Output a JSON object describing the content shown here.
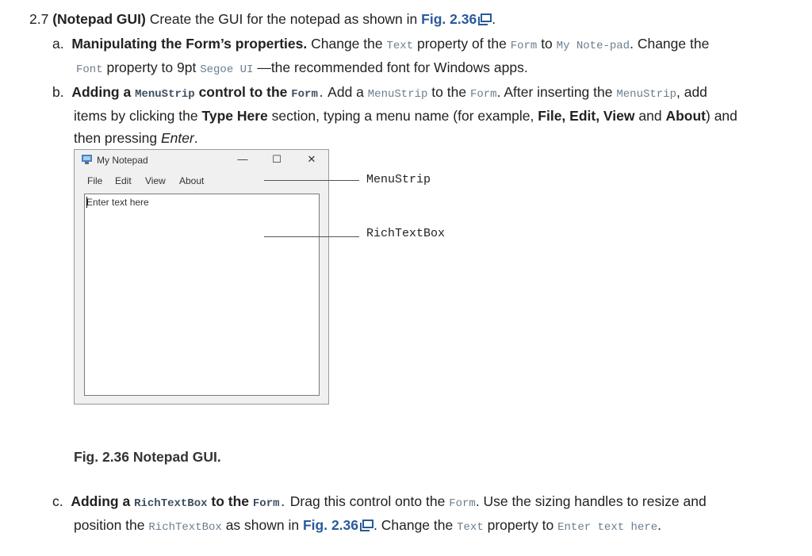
{
  "exercise": {
    "number": "2.7",
    "title": "(Notepad GUI)",
    "intro": "Create the GUI for the notepad as shown in",
    "fig_ref": "Fig. 2.36",
    "end": "."
  },
  "item_a": {
    "letter": "a.",
    "heading": "Manipulating the Form’s properties.",
    "t1": "Change the",
    "c1": "Text",
    "t2": "property of the",
    "c2": "Form",
    "t3": "to",
    "c3": "My Note-pad",
    "t4": ". Change the",
    "c4": "Font",
    "t5": "property to 9pt",
    "c5": "Segoe UI",
    "t6": "—the recommended font for Windows apps."
  },
  "item_b": {
    "letter": "b.",
    "h1": "Adding a",
    "hc1": "MenuStrip",
    "h2": "control to the",
    "hc2": "Form.",
    "t1": "Add a",
    "c1": "MenuStrip",
    "t2": "to the",
    "c2": "Form",
    "t3": ". After inserting the",
    "c3": "MenuStrip",
    "t4": ", add",
    "l2a": "items by clicking the",
    "l2b": "Type Here",
    "l2c": "section, typing a menu name (for example,",
    "l2d": "File, Edit, View",
    "l2e": "and",
    "l2f": "About",
    "l2g": ") and",
    "l3a": "then pressing",
    "l3b": "Enter",
    "l3c": "."
  },
  "window": {
    "title": "My Notepad",
    "minimize": "—",
    "maximize": "☐",
    "close": "✕",
    "menu": [
      "File",
      "Edit",
      "View",
      "About"
    ],
    "textbox_text": "Enter text here"
  },
  "callouts": {
    "menustrip": "MenuStrip",
    "richtextbox": "RichTextBox"
  },
  "figure_caption": "Fig. 2.36 Notepad GUI.",
  "item_c": {
    "letter": "c.",
    "h1": "Adding a",
    "hc1": "RichTextBox",
    "h2": "to the",
    "hc2": "Form.",
    "t1": "Drag this control onto the",
    "c1": "Form",
    "t2": ". Use the sizing handles to resize and",
    "l2a": "position the",
    "l2c": "RichTextBox",
    "l2b": "as shown in",
    "fig_ref": "Fig. 2.36",
    "l2d": ". Change the",
    "c2": "Text",
    "l2e": "property to",
    "c3": "Enter text here",
    "l2f": "."
  },
  "colors": {
    "link": "#2a5a9b",
    "code": "#6b7e8f"
  },
  "icons": [
    "external-link-icon",
    "notepad-app-icon"
  ]
}
